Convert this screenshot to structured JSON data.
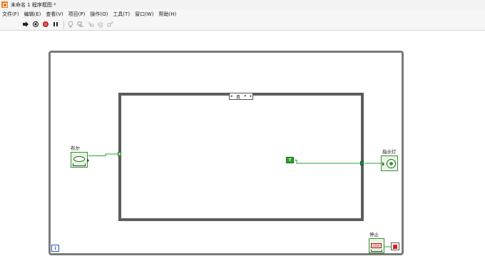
{
  "window": {
    "title": "未命名 1 程序框图 *"
  },
  "menu": {
    "items": [
      "文件(F)",
      "编辑(E)",
      "查看(V)",
      "项目(P)",
      "操作(O)",
      "工具(T)",
      "窗口(W)",
      "帮助(H)"
    ]
  },
  "toolbar": {
    "buttons": [
      {
        "name": "run-arrow-icon"
      },
      {
        "name": "run-continuously-icon"
      },
      {
        "name": "abort-execution-icon"
      },
      {
        "name": "pause-icon"
      },
      {
        "name": "highlight-execution-icon"
      },
      {
        "name": "retain-wire-values-icon"
      },
      {
        "name": "step-into-icon"
      },
      {
        "name": "step-over-icon"
      },
      {
        "name": "step-out-icon"
      }
    ]
  },
  "diagram": {
    "case_selector": {
      "value": "真",
      "arrow": "▾"
    },
    "bool_control": {
      "label": "布尔"
    },
    "true_constant": {
      "text": "T"
    },
    "led_indicator": {
      "label": "指示灯"
    },
    "stop_control": {
      "label": "停止",
      "button_text": "STOP"
    },
    "iteration_terminal": {
      "text": "i"
    }
  },
  "colors": {
    "boolean_wire": "#2ca02c",
    "while_loop_border": "#7a7a7a",
    "case_border": "#5c5c5c",
    "stop_sign": "#e01b1b",
    "iteration_terminal": "#2a52be"
  }
}
